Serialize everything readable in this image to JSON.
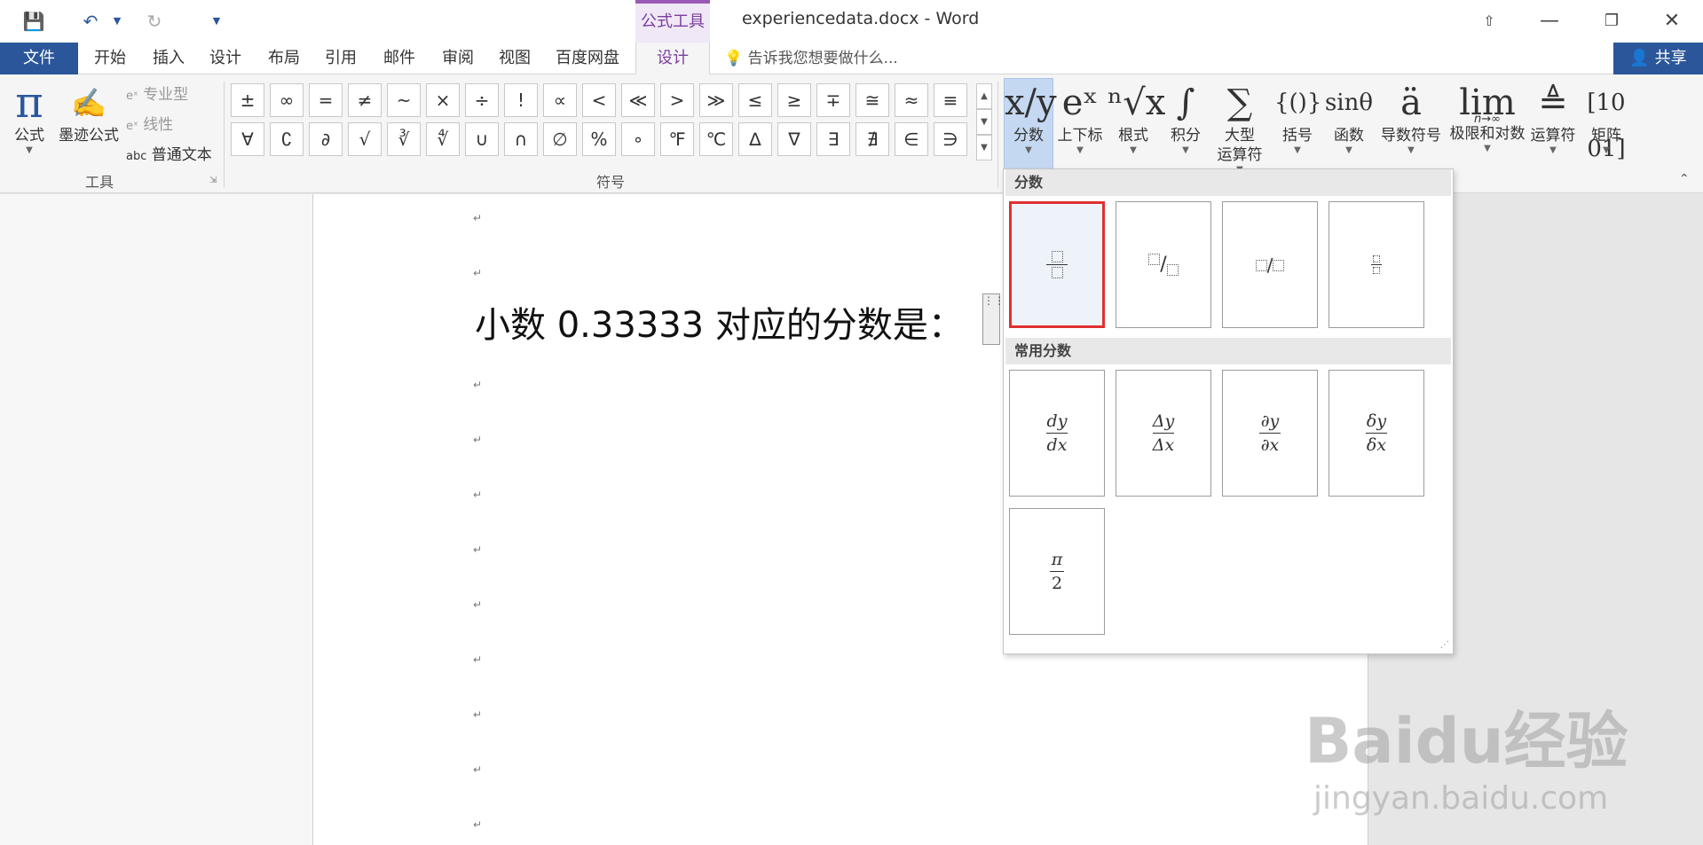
{
  "titlebar": {
    "doc_title": "experiencedata.docx - Word",
    "context_tab_group": "公式工具",
    "qat": {
      "save_icon": "save-icon",
      "undo_icon": "undo-icon",
      "redo_icon": "redo-icon"
    }
  },
  "tabs": {
    "file": "文件",
    "items": [
      "开始",
      "插入",
      "设计",
      "布局",
      "引用",
      "邮件",
      "审阅",
      "视图",
      "百度网盘"
    ],
    "active": "设计",
    "tell_me": "告诉我您想要做什么...",
    "share": "共享"
  },
  "ribbon": {
    "tools": {
      "group_label": "工具",
      "equation": "公式",
      "ink_equation": "墨迹公式",
      "professional": "专业型",
      "linear": "线性",
      "plain_text": "普通文本",
      "plain_text_prefix": "abc"
    },
    "symbols": {
      "group_label": "符号",
      "row1": [
        "±",
        "∞",
        "=",
        "≠",
        "~",
        "×",
        "÷",
        "!",
        "∝",
        "<",
        "≪",
        ">",
        "≫",
        "≤",
        "≥",
        "∓",
        "≅",
        "≈",
        "≡"
      ],
      "row2": [
        "∀",
        "∁",
        "∂",
        "√",
        "∛",
        "∜",
        "∪",
        "∩",
        "∅",
        "%",
        "∘",
        "℉",
        "℃",
        "∆",
        "∇",
        "∃",
        "∄",
        "∈",
        "∋"
      ]
    },
    "structures": [
      {
        "label": "分数",
        "icon": "x/y"
      },
      {
        "label": "上下标",
        "icon": "eˣ"
      },
      {
        "label": "根式",
        "icon": "ⁿ√x"
      },
      {
        "label": "积分",
        "icon": "∫"
      },
      {
        "label": "大型",
        "label2": "运算符",
        "icon": "∑"
      },
      {
        "label": "括号",
        "icon": "{()}"
      },
      {
        "label": "函数",
        "icon": "sinθ"
      },
      {
        "label": "导数符号",
        "icon": "ä"
      },
      {
        "label": "极限和对数",
        "icon": "lim",
        "icon_sub": "n→∞"
      },
      {
        "label": "运算符",
        "icon": "≜"
      },
      {
        "label": "矩阵",
        "icon": "[10 01]"
      }
    ]
  },
  "document": {
    "text": "小数  0.33333  对应的分数是："
  },
  "dropdown": {
    "section1": "分数",
    "section2": "常用分数",
    "common": [
      {
        "num": "dy",
        "den": "dx"
      },
      {
        "num": "Δy",
        "den": "Δx"
      },
      {
        "num": "∂y",
        "den": "∂x"
      },
      {
        "num": "δy",
        "den": "δx"
      },
      {
        "num": "π",
        "den": "2"
      }
    ]
  },
  "watermark": {
    "main": "Baidu经验",
    "sub": "jingyan.baidu.com"
  }
}
